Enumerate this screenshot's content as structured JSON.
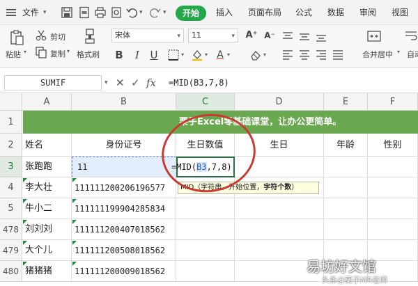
{
  "menubar": {
    "file_label": "文件",
    "tabs": [
      "开始",
      "插入",
      "页面布局",
      "公式",
      "数据",
      "审阅",
      "视图"
    ]
  },
  "ribbon": {
    "cut_label": "剪切",
    "copy_label": "复制",
    "paste_label": "粘贴",
    "painter_label": "格式刷",
    "font_name": "宋体",
    "font_size": "11",
    "merge_label": "合并居中",
    "wrap_label": "自动换行"
  },
  "formula_bar": {
    "name_box": "SUMIF",
    "formula": "=MID(B3,7,8)"
  },
  "sheet": {
    "columns": [
      "A",
      "B",
      "C",
      "D",
      "E",
      "F"
    ],
    "banner": "栗子Excel零基础课堂，让办公更简单。",
    "headers": [
      "姓名",
      "身份证号",
      "生日数值",
      "生日",
      "年龄",
      "性别"
    ],
    "row_numbers": [
      "1",
      "2",
      "3",
      "4",
      "5",
      "478",
      "479",
      "480"
    ],
    "editing": {
      "prefix": "=MID(",
      "ref": "B3",
      "suffix": ",7,8)"
    },
    "tooltip": {
      "prefix": "MID（字符串，开始位置，",
      "bold": "字符个数",
      "suffix": "）"
    },
    "rows": [
      {
        "name": "张跑跑",
        "id": "11"
      },
      {
        "name": "李大壮",
        "id": "111111200206196577"
      },
      {
        "name": "牛小二",
        "id": "111111199904285834"
      },
      {
        "name": "刘刘刘",
        "id": "111111200407018562"
      },
      {
        "name": "大个儿",
        "id": "111111200508018562"
      },
      {
        "name": "猪猪猪",
        "id": "111111200009018562"
      }
    ]
  },
  "watermark": {
    "main": "易坊好文馆",
    "sub": "头条@栗子MR老师"
  }
}
